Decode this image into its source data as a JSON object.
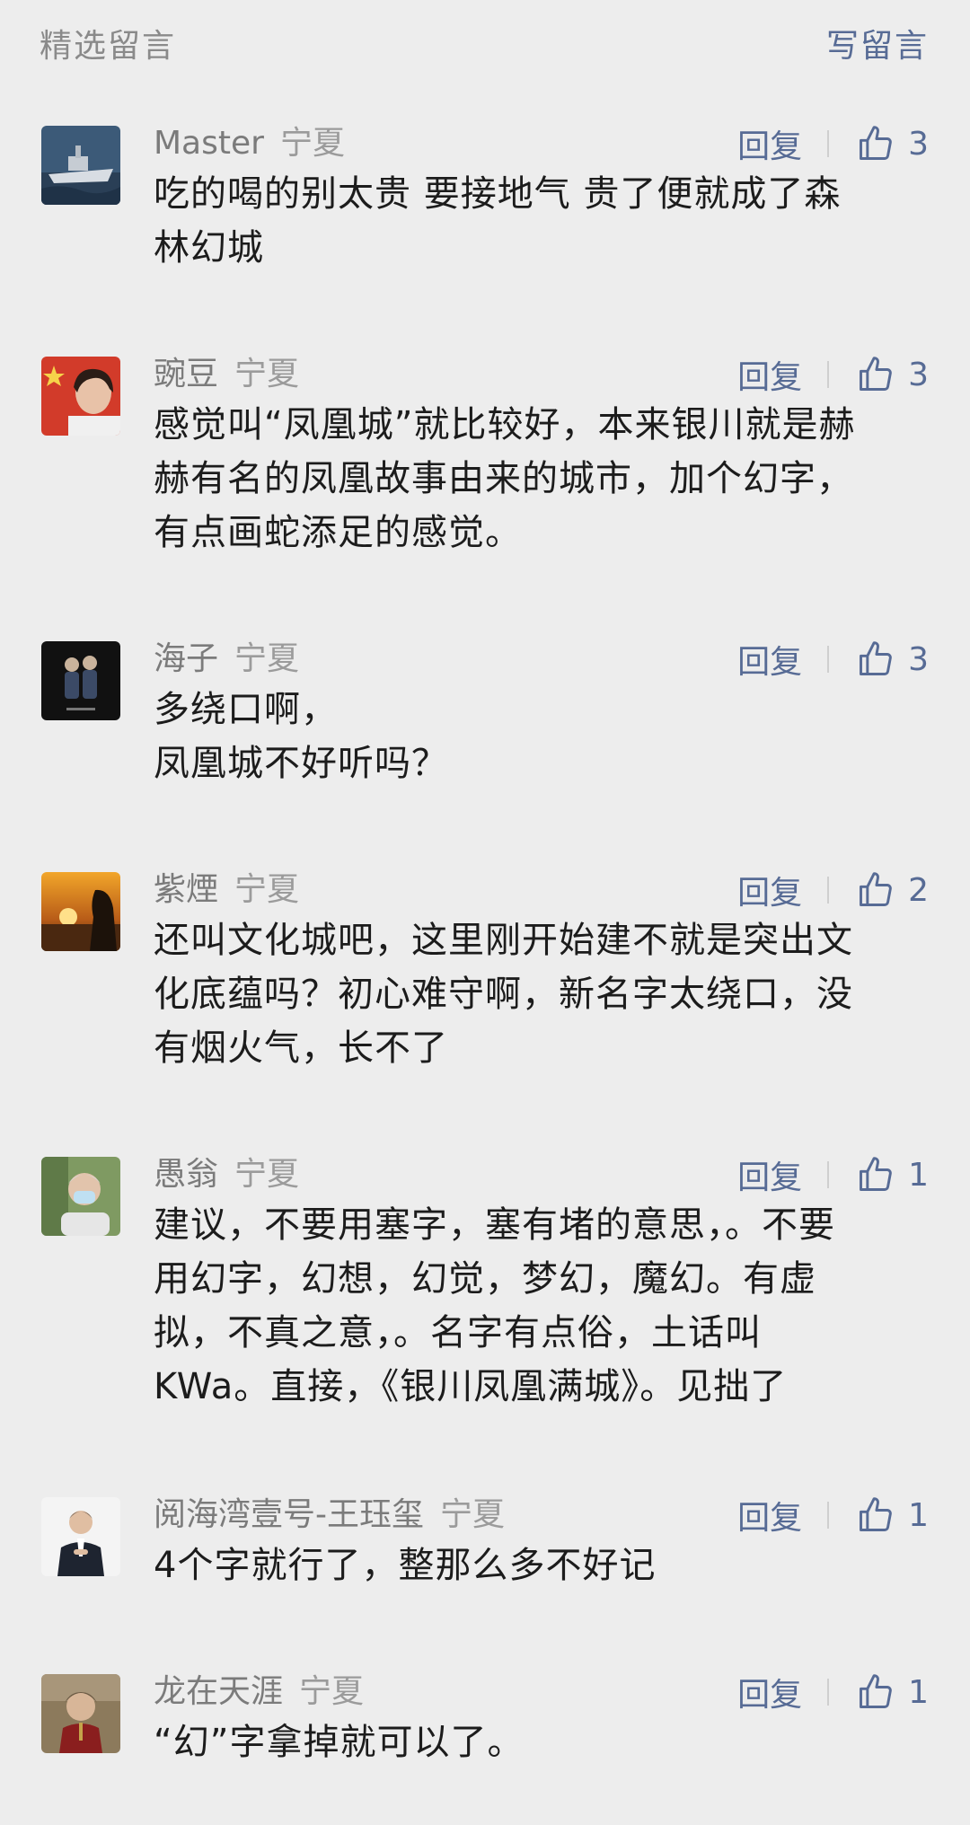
{
  "header": {
    "title": "精选留言",
    "write_label": "写留言"
  },
  "comments": [
    {
      "nickname": "Master",
      "location": "宁夏",
      "reply_label": "回复",
      "likes": "3",
      "text": "吃的喝的别太贵 要接地气 贵了便就成了森\n林幻城"
    },
    {
      "nickname": "豌豆",
      "location": "宁夏",
      "reply_label": "回复",
      "likes": "3",
      "text": "感觉叫“凤凰城”就比较好，本来银川就是赫\n赫有名的凤凰故事由来的城市，加个幻字，\n有点画蛇添足的感觉。"
    },
    {
      "nickname": "海子",
      "location": "宁夏",
      "reply_label": "回复",
      "likes": "3",
      "text": "多绕口啊，\n凤凰城不好听吗？"
    },
    {
      "nickname": "紫煙",
      "location": "宁夏",
      "reply_label": "回复",
      "likes": "2",
      "text": "还叫文化城吧，这里刚开始建不就是突出文\n化底蕴吗？初心难守啊，新名字太绕口，没\n有烟火气，长不了"
    },
    {
      "nickname": "愚翁",
      "location": "宁夏",
      "reply_label": "回复",
      "likes": "1",
      "text": "建议，不要用塞字，塞有堵的意思，。不要\n用幻字，幻想，幻觉，梦幻，魔幻。有虚\n拟，不真之意，。名字有点俗，土话叫\nKWa。直接，《银川凤凰满城》。见拙了"
    },
    {
      "nickname": "阅海湾壹号-王珏玺",
      "location": "宁夏",
      "reply_label": "回复",
      "likes": "1",
      "text": "4个字就行了，整那么多不好记"
    },
    {
      "nickname": "龙在天涯",
      "location": "宁夏",
      "reply_label": "回复",
      "likes": "1",
      "text": "“幻”字拿掉就可以了。"
    }
  ]
}
